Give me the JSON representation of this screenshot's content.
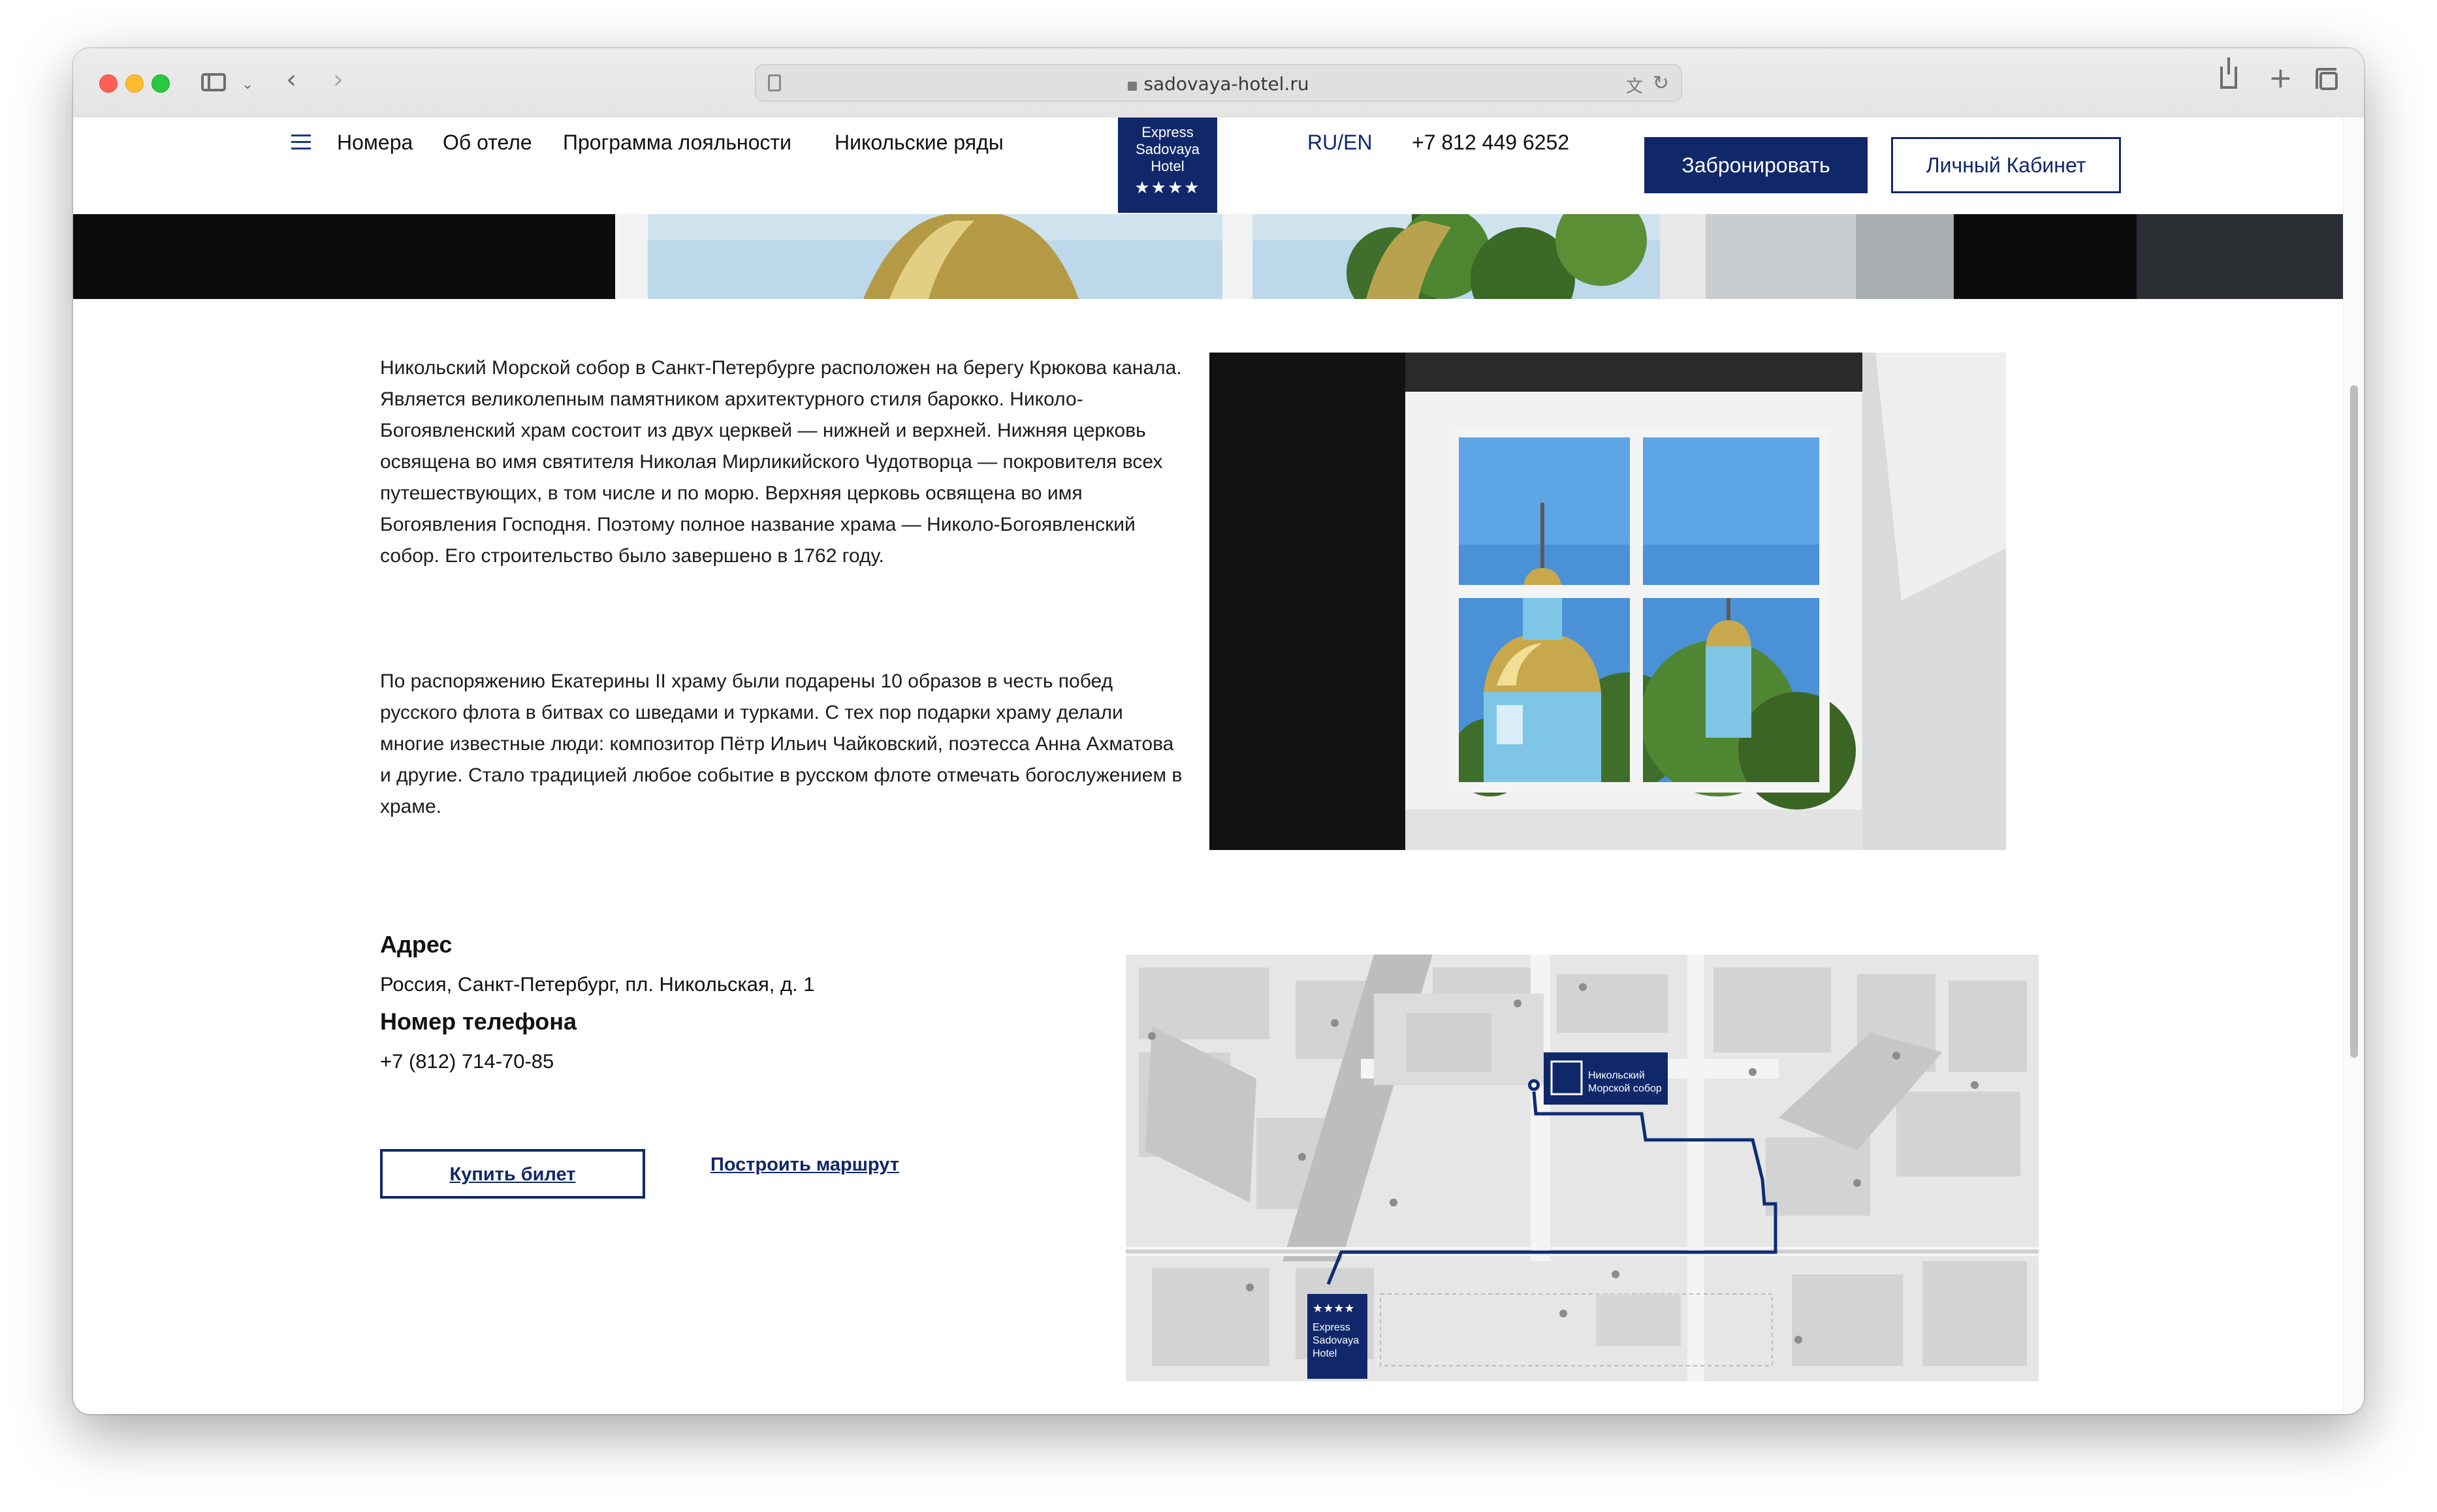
{
  "browser": {
    "url": "sadovaya-hotel.ru"
  },
  "header": {
    "nav": [
      "Номера",
      "Об отеле",
      "Программа лояльности",
      "Никольские ряды"
    ],
    "logo_lines": [
      "Express",
      "Sadovaya",
      "Hotel"
    ],
    "logo_stars": "★★★★",
    "lang": "RU/EN",
    "phone": "+7 812 449 6252",
    "book_label": "Забронировать",
    "cabinet_label": "Личный Кабинет"
  },
  "content": {
    "paragraph1": "Никольский Морской собор в Санкт-Петербурге расположен на берегу Крюкова канала. Является великолепным памятником архитектурного стиля барокко. Николо-Богоявленский храм состоит из двух церквей — нижней и верхней. Нижняя церковь освящена во имя святителя Николая Мирликийского Чудотворца — покровителя всех путешествующих, в том числе и по морю. Верхняя церковь освящена во имя Богоявления Господня. Поэтому полное название храма — Николо-Богоявленский собор. Его строительство было завершено в 1762 году.",
    "paragraph2": "По распоряжению Екатерины II храму были подарены 10 образов в честь побед русского флота в битвах со шведами и турками. С тех пор подарки храму делали многие известные люди: композитор Пётр Ильич Чайковский, поэтесса Анна Ахматова и другие. Стало традицией любое событие в русском флоте отмечать богослужением в храме."
  },
  "contact": {
    "address_label": "Адрес",
    "address": "Россия, Санкт-Петербург, пл. Никольская, д. 1",
    "phone_label": "Номер телефона",
    "phone": "+7 (812) 714-70-85",
    "ticket_button": "Купить билет",
    "route_link": "Построить маршрут"
  },
  "map": {
    "cathedral_label_1": "Никольский",
    "cathedral_label_2": "Морской собор",
    "hotel_stars": "★★★★",
    "hotel_lines": [
      "Express",
      "Sadovaya",
      "Hotel"
    ]
  },
  "colors": {
    "brand": "#10286a",
    "route": "#0e2c74"
  }
}
